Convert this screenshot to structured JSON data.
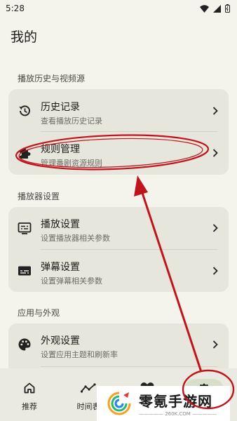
{
  "status_bar": {
    "time": "5:28"
  },
  "page": {
    "title": "我的"
  },
  "sections": [
    {
      "title": "播放历史与视频源",
      "items": [
        {
          "title": "历史记录",
          "subtitle": "查看播放历史记录",
          "icon": "history-icon"
        },
        {
          "title": "规则管理",
          "subtitle": "管理番剧资源规则",
          "icon": "puzzle-icon"
        }
      ]
    },
    {
      "title": "播放器设置",
      "items": [
        {
          "title": "播放设置",
          "subtitle": "设置播放器相关参数",
          "icon": "player-settings-icon"
        },
        {
          "title": "弹幕设置",
          "subtitle": "设置弹幕相关参数",
          "icon": "subtitles-icon"
        }
      ]
    },
    {
      "title": "应用与外观",
      "items": [
        {
          "title": "外观设置",
          "subtitle": "设置应用主题和刷新率",
          "icon": "palette-icon"
        }
      ]
    }
  ],
  "bottom_nav": [
    {
      "label": "推荐",
      "icon": "home-icon"
    },
    {
      "label": "时间表",
      "icon": "timeline-icon"
    },
    {
      "label": "",
      "icon": "heart-icon"
    },
    {
      "label": "",
      "icon": "gear-icon",
      "selected": true
    }
  ],
  "watermark": {
    "title": "零氪手游网",
    "url": "————— 260K.COM —————"
  },
  "colors": {
    "annotation": "#c0141c",
    "card": "#e7e6dd",
    "background": "#f4f3ec"
  }
}
